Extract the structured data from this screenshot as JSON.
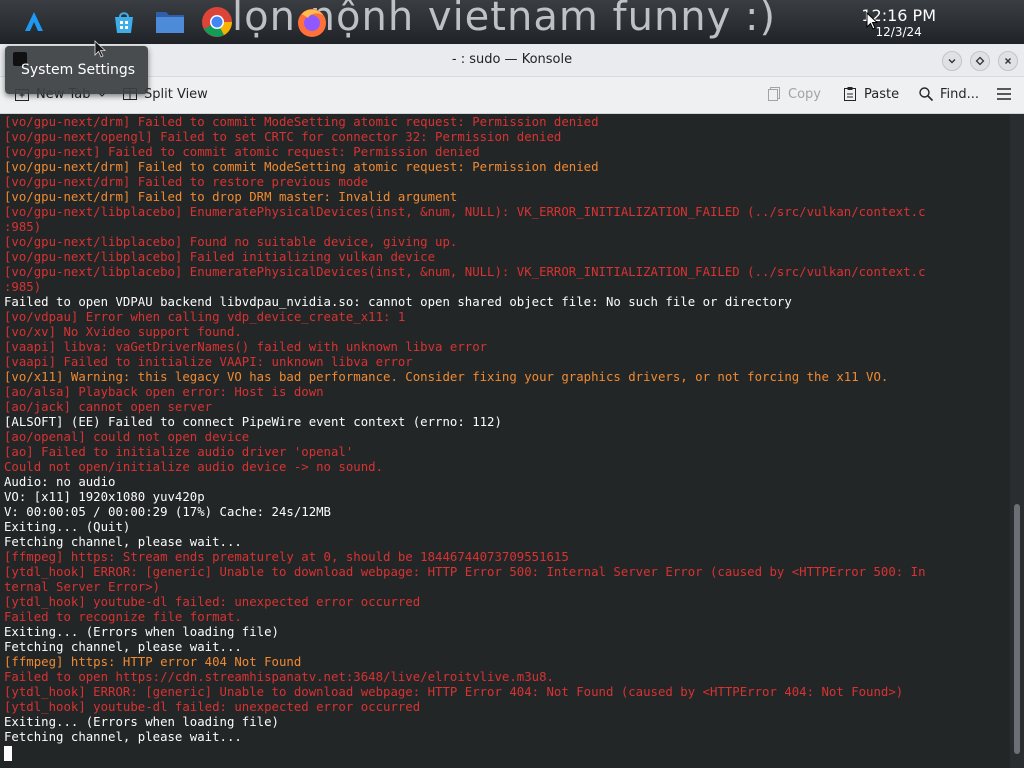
{
  "panel": {
    "wallpaper_text": "lọn nộnh vietnam funny :)",
    "apps": [
      {
        "name": "kde-launcher",
        "color": "#1d99f3"
      },
      {
        "name": "discover-store",
        "color": "#3daee9"
      },
      {
        "name": "file-manager",
        "color": "#4d7cc7"
      },
      {
        "name": "chrome",
        "color": "#db4437"
      },
      {
        "name": "firefox",
        "color": "#ff7139"
      }
    ],
    "clock": {
      "time": "12:16 PM",
      "date": "12/3/24"
    }
  },
  "window": {
    "title": "- : sudo — Konsole",
    "buttons": [
      "minimize",
      "maximize",
      "close"
    ]
  },
  "tooltip": {
    "text": "System Settings"
  },
  "toolbar": {
    "new_tab_label": "New Tab",
    "split_view_label": "Split View",
    "copy_label": "Copy",
    "paste_label": "Paste",
    "find_label": "Find..."
  },
  "terminal": {
    "lines": [
      {
        "t": "[vo/gpu-next/drm] Failed to commit ModeSetting atomic request: Permission denied",
        "c": "red"
      },
      {
        "t": "[vo/gpu-next/opengl] Failed to set CRTC for connector 32: Permission denied",
        "c": "red"
      },
      {
        "t": "[vo/gpu-next] Failed to commit atomic request: Permission denied",
        "c": "red"
      },
      {
        "t": "[vo/gpu-next/drm] Failed to commit ModeSetting atomic request: Permission denied",
        "c": "orange"
      },
      {
        "t": "[vo/gpu-next/drm] Failed to restore previous mode",
        "c": "red"
      },
      {
        "t": "[vo/gpu-next/drm] Failed to drop DRM master: Invalid argument",
        "c": "orange"
      },
      {
        "t": "[vo/gpu-next/libplacebo] EnumeratePhysicalDevices(inst, &num, NULL): VK_ERROR_INITIALIZATION_FAILED (../src/vulkan/context.c",
        "c": "red"
      },
      {
        "t": ":985)",
        "c": "red"
      },
      {
        "t": "[vo/gpu-next/libplacebo] Found no suitable device, giving up.",
        "c": "red"
      },
      {
        "t": "[vo/gpu-next/libplacebo] Failed initializing vulkan device",
        "c": "red"
      },
      {
        "t": "[vo/gpu-next/libplacebo] EnumeratePhysicalDevices(inst, &num, NULL): VK_ERROR_INITIALIZATION_FAILED (../src/vulkan/context.c",
        "c": "red"
      },
      {
        "t": ":985)",
        "c": "red"
      },
      {
        "t": "Failed to open VDPAU backend libvdpau_nvidia.so: cannot open shared object file: No such file or directory",
        "c": "white"
      },
      {
        "t": "[vo/vdpau] Error when calling vdp_device_create_x11: 1",
        "c": "red"
      },
      {
        "t": "[vo/xv] No Xvideo support found.",
        "c": "red"
      },
      {
        "t": "[vaapi] libva: vaGetDriverNames() failed with unknown libva error",
        "c": "red"
      },
      {
        "t": "[vaapi] Failed to initialize VAAPI: unknown libva error",
        "c": "red"
      },
      {
        "t": "[vo/x11] Warning: this legacy VO has bad performance. Consider fixing your graphics drivers, or not forcing the x11 VO.",
        "c": "orange"
      },
      {
        "t": "[ao/alsa] Playback open error: Host is down",
        "c": "red"
      },
      {
        "t": "[ao/jack] cannot open server",
        "c": "red"
      },
      {
        "t": "[ALSOFT] (EE) Failed to connect PipeWire event context (errno: 112)",
        "c": "white"
      },
      {
        "t": "[ao/openal] could not open device",
        "c": "red"
      },
      {
        "t": "[ao] Failed to initialize audio driver 'openal'",
        "c": "red"
      },
      {
        "t": "Could not open/initialize audio device -> no sound.",
        "c": "red"
      },
      {
        "t": "Audio: no audio",
        "c": "white"
      },
      {
        "t": "VO: [x11] 1920x1080 yuv420p",
        "c": "white"
      },
      {
        "t": "V: 00:00:05 / 00:00:29 (17%) Cache: 24s/12MB",
        "c": "white"
      },
      {
        "t": "Exiting... (Quit)",
        "c": "white"
      },
      {
        "t": "Fetching channel, please wait...",
        "c": "white"
      },
      {
        "t": "[ffmpeg] https: Stream ends prematurely at 0, should be 18446744073709551615",
        "c": "red"
      },
      {
        "t": "[ytdl_hook] ERROR: [generic] Unable to download webpage: HTTP Error 500: Internal Server Error (caused by <HTTPError 500: In",
        "c": "red"
      },
      {
        "t": "ternal Server Error>)",
        "c": "red"
      },
      {
        "t": "[ytdl_hook] youtube-dl failed: unexpected error occurred",
        "c": "red"
      },
      {
        "t": "Failed to recognize file format.",
        "c": "red"
      },
      {
        "t": "Exiting... (Errors when loading file)",
        "c": "white"
      },
      {
        "t": "Fetching channel, please wait...",
        "c": "white"
      },
      {
        "t": "[ffmpeg] https: HTTP error 404 Not Found",
        "c": "orange"
      },
      {
        "t": "Failed to open https://cdn.streamhispanatv.net:3648/live/elroitvlive.m3u8.",
        "c": "red"
      },
      {
        "t": "[ytdl_hook] ERROR: [generic] Unable to download webpage: HTTP Error 404: Not Found (caused by <HTTPError 404: Not Found>)",
        "c": "red"
      },
      {
        "t": "[ytdl_hook] youtube-dl failed: unexpected error occurred",
        "c": "red"
      },
      {
        "t": "Exiting... (Errors when loading file)",
        "c": "white"
      },
      {
        "t": "Fetching channel, please wait...",
        "c": "white"
      }
    ]
  }
}
